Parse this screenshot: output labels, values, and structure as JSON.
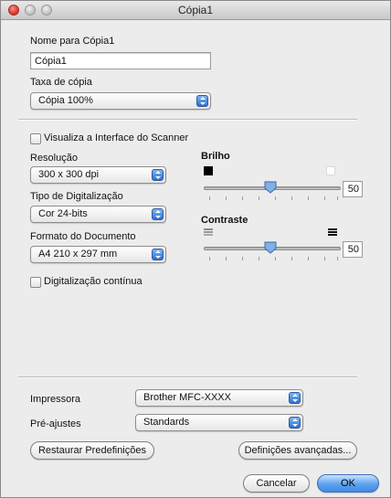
{
  "window": {
    "title": "Cópia1"
  },
  "name_section": {
    "label": "Nome para Cópia1",
    "value": "Cópia1"
  },
  "rate_section": {
    "label": "Taxa de cópia",
    "selected": "Cópia 100%"
  },
  "scanner_interface": {
    "label": "Visualiza a Interface do Scanner",
    "checked": false
  },
  "resolution": {
    "label": "Resolução",
    "selected": "300 x 300 dpi"
  },
  "scan_type": {
    "label": "Tipo de Digitalização",
    "selected": "Cor 24-bits"
  },
  "document_size": {
    "label": "Formato do Documento",
    "selected": "A4 210 x 297 mm"
  },
  "brightness": {
    "label": "Brilho",
    "value": "50",
    "level": 0.5
  },
  "contrast": {
    "label": "Contraste",
    "value": "50",
    "level": 0.5
  },
  "continuous_scan": {
    "label": "Digitalização contínua",
    "checked": false
  },
  "printer": {
    "label": "Impressora",
    "selected": "Brother MFC-XXXX"
  },
  "presets": {
    "label": "Pré-ajustes",
    "selected": "Standards"
  },
  "buttons": {
    "restore": "Restaurar Predefinições",
    "advanced": "Definições avançadas...",
    "cancel": "Cancelar",
    "ok": "OK"
  },
  "colors": {
    "accent": "#3f8be6",
    "close": "#d0302a"
  }
}
